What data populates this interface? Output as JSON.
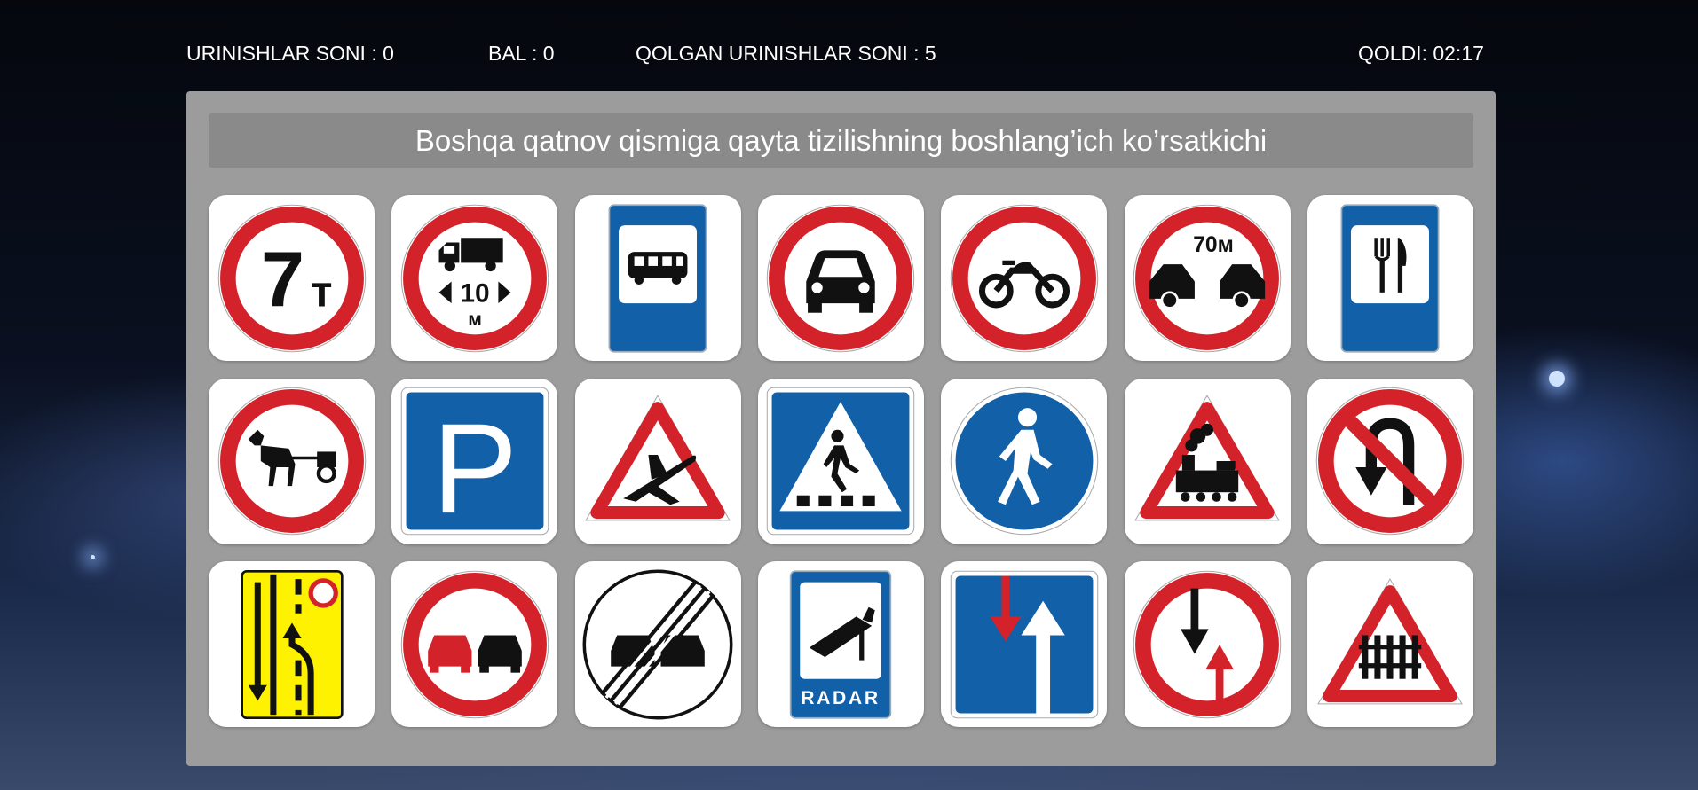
{
  "header": {
    "attempts": "URINISHLAR SONI : 0",
    "score": "BAL : 0",
    "remaining_attempts": "QOLGAN URINISHLAR SONI : 5",
    "timer": "QOLDI: 02:17"
  },
  "question": "Boshqa qatnov qismiga qayta tizilishning boshlang’ich ko’rsatkichi",
  "signs": [
    {
      "icon": "weight-limit-7t-sign-icon",
      "texts": {
        "big": "7",
        "unit": "т"
      }
    },
    {
      "icon": "truck-length-limit-sign-icon",
      "texts": {
        "num": "10",
        "unit": "м"
      }
    },
    {
      "icon": "bus-stop-sign-icon",
      "texts": {}
    },
    {
      "icon": "no-cars-sign-icon",
      "texts": {}
    },
    {
      "icon": "no-motorcycles-sign-icon",
      "texts": {}
    },
    {
      "icon": "minimum-distance-70m-sign-icon",
      "texts": {
        "dist": "70м"
      }
    },
    {
      "icon": "restaurant-sign-icon",
      "texts": {}
    },
    {
      "icon": "no-horse-carts-sign-icon",
      "texts": {}
    },
    {
      "icon": "parking-sign-icon",
      "texts": {
        "p": "P"
      }
    },
    {
      "icon": "low-flying-aircraft-sign-icon",
      "texts": {}
    },
    {
      "icon": "pedestrian-crossing-sign-icon",
      "texts": {}
    },
    {
      "icon": "pedestrian-path-sign-icon",
      "texts": {}
    },
    {
      "icon": "railway-crossing-no-barrier-sign-icon",
      "texts": {}
    },
    {
      "icon": "no-u-turn-sign-icon",
      "texts": {}
    },
    {
      "icon": "lane-merge-yellow-sign-icon",
      "texts": {}
    },
    {
      "icon": "no-overtaking-sign-icon",
      "texts": {}
    },
    {
      "icon": "end-of-no-overtaking-sign-icon",
      "texts": {}
    },
    {
      "icon": "radar-camera-sign-icon",
      "texts": {
        "radar": "RADAR"
      }
    },
    {
      "icon": "lane-direction-sign-icon",
      "texts": {}
    },
    {
      "icon": "yield-oncoming-traffic-sign-icon",
      "texts": {}
    },
    {
      "icon": "railway-crossing-barrier-sign-icon",
      "texts": {}
    }
  ],
  "colors": {
    "red": "#d4222a",
    "blue": "#1160a8",
    "yellow": "#fff200",
    "board": "#9c9c9c"
  }
}
